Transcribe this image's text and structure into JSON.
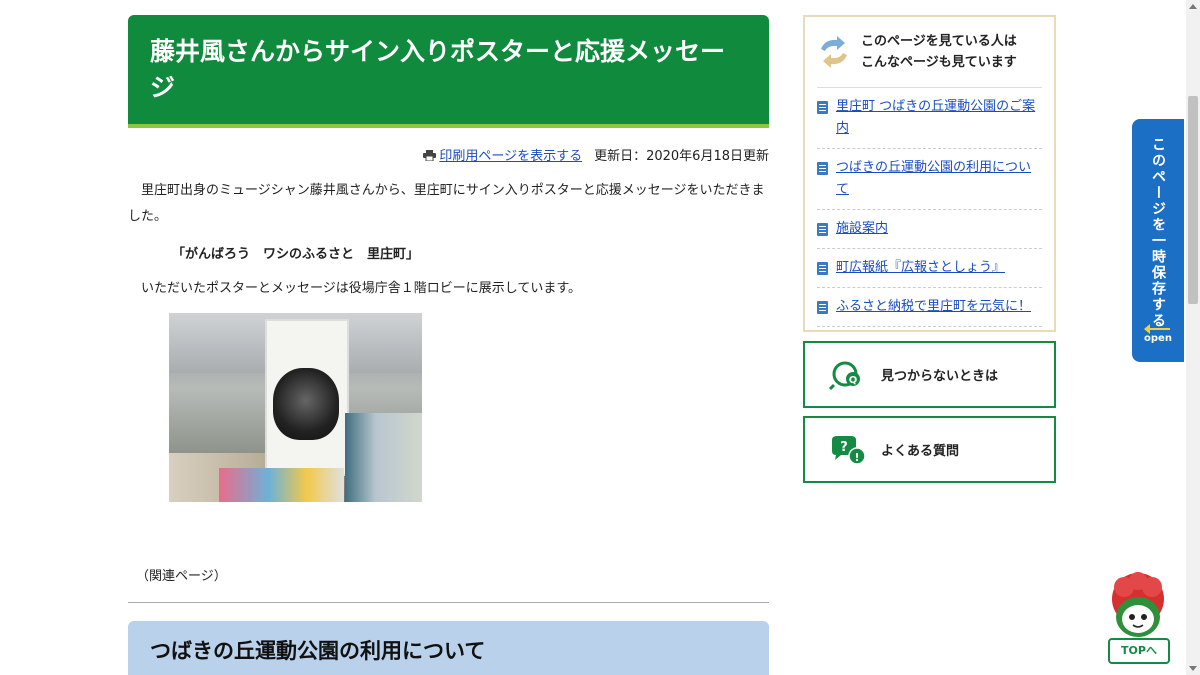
{
  "article": {
    "title": "藤井風さんからサイン入りポスターと応援メッセージ",
    "print_link": "印刷用ページを表示する",
    "updated": "更新日：2020年6月18日更新",
    "paragraph1": "里庄町出身のミュージシャン藤井風さんから、里庄町にサイン入りポスターと応援メッセージをいただきました。",
    "quote": "「がんばろう　ワシのふるさと　里庄町」",
    "paragraph2": "いただいたポスターとメッセージは役場庁舎１階ロビーに展示しています。",
    "related_label": "（関連ページ）",
    "related_heading": "つばきの丘運動公園の利用について"
  },
  "sidebar": {
    "also_viewed_heading": "このページを見ている人は\nこんなページも見ています",
    "also_viewed_items": [
      "里庄町 つばきの丘運動公園のご案内",
      "つばきの丘運動公園の利用について",
      "施設案内",
      "町広報紙『広報さとしょう』",
      "ふるさと納税で里庄町を元気に！"
    ],
    "not_found_label": "見つからないときは",
    "faq_label": "よくある質問"
  },
  "save_tab": {
    "label": "このページを一時保存する",
    "open": "open"
  },
  "top_button": {
    "label": "TOPへ"
  },
  "colors": {
    "title_bg": "#108a3c",
    "title_underline": "#8dc63f",
    "link": "#1a4dbf",
    "sub_heading_bg": "#b9d1ea",
    "accent_green": "#148a43",
    "save_tab": "#1b6fc4"
  }
}
